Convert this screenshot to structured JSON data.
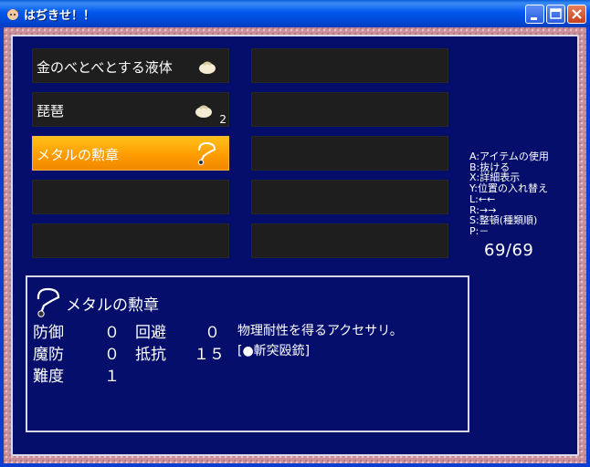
{
  "window": {
    "title": "はぢきせ！！",
    "minimize_icon": "minimize-icon",
    "maximize_icon": "maximize-icon",
    "close_icon": "close-icon"
  },
  "colors": {
    "panel_bg": "#050f6b",
    "slot_bg": "#1e1e1e",
    "selected_slot": "#ff9c00",
    "text": "#ffffff"
  },
  "inventory": {
    "slots": [
      {
        "label": "金のべとべとする液体",
        "icon": "pouch-icon",
        "count": ""
      },
      {
        "label": "",
        "icon": "",
        "count": ""
      },
      {
        "label": "琵琶",
        "icon": "pouch-icon",
        "count": "2"
      },
      {
        "label": "",
        "icon": "",
        "count": ""
      },
      {
        "label": "メタルの勲章",
        "icon": "medal-icon",
        "count": "",
        "selected": true
      },
      {
        "label": "",
        "icon": "",
        "count": ""
      },
      {
        "label": "",
        "icon": "",
        "count": ""
      },
      {
        "label": "",
        "icon": "",
        "count": ""
      },
      {
        "label": "",
        "icon": "",
        "count": ""
      },
      {
        "label": "",
        "icon": "",
        "count": ""
      }
    ]
  },
  "help": {
    "lines": [
      "A:アイテムの使用",
      "B:抜ける",
      "X:詳細表示",
      "Y:位置の入れ替え",
      "L:←←",
      "R:→→",
      "S:整頓(種類順)",
      "P:－"
    ],
    "capacity": "69/69"
  },
  "detail": {
    "item_name": "メタルの勲章",
    "icon": "medal-icon",
    "stats": [
      {
        "label": "防御",
        "value": "０"
      },
      {
        "label": "回避",
        "value": "０"
      },
      {
        "label": "魔防",
        "value": "０"
      },
      {
        "label": "抵抗",
        "value": "１５"
      },
      {
        "label": "難度",
        "value": "１"
      }
    ],
    "description": "物理耐性を得るアクセサリ。",
    "tag": "[●斬突殴銃]"
  }
}
